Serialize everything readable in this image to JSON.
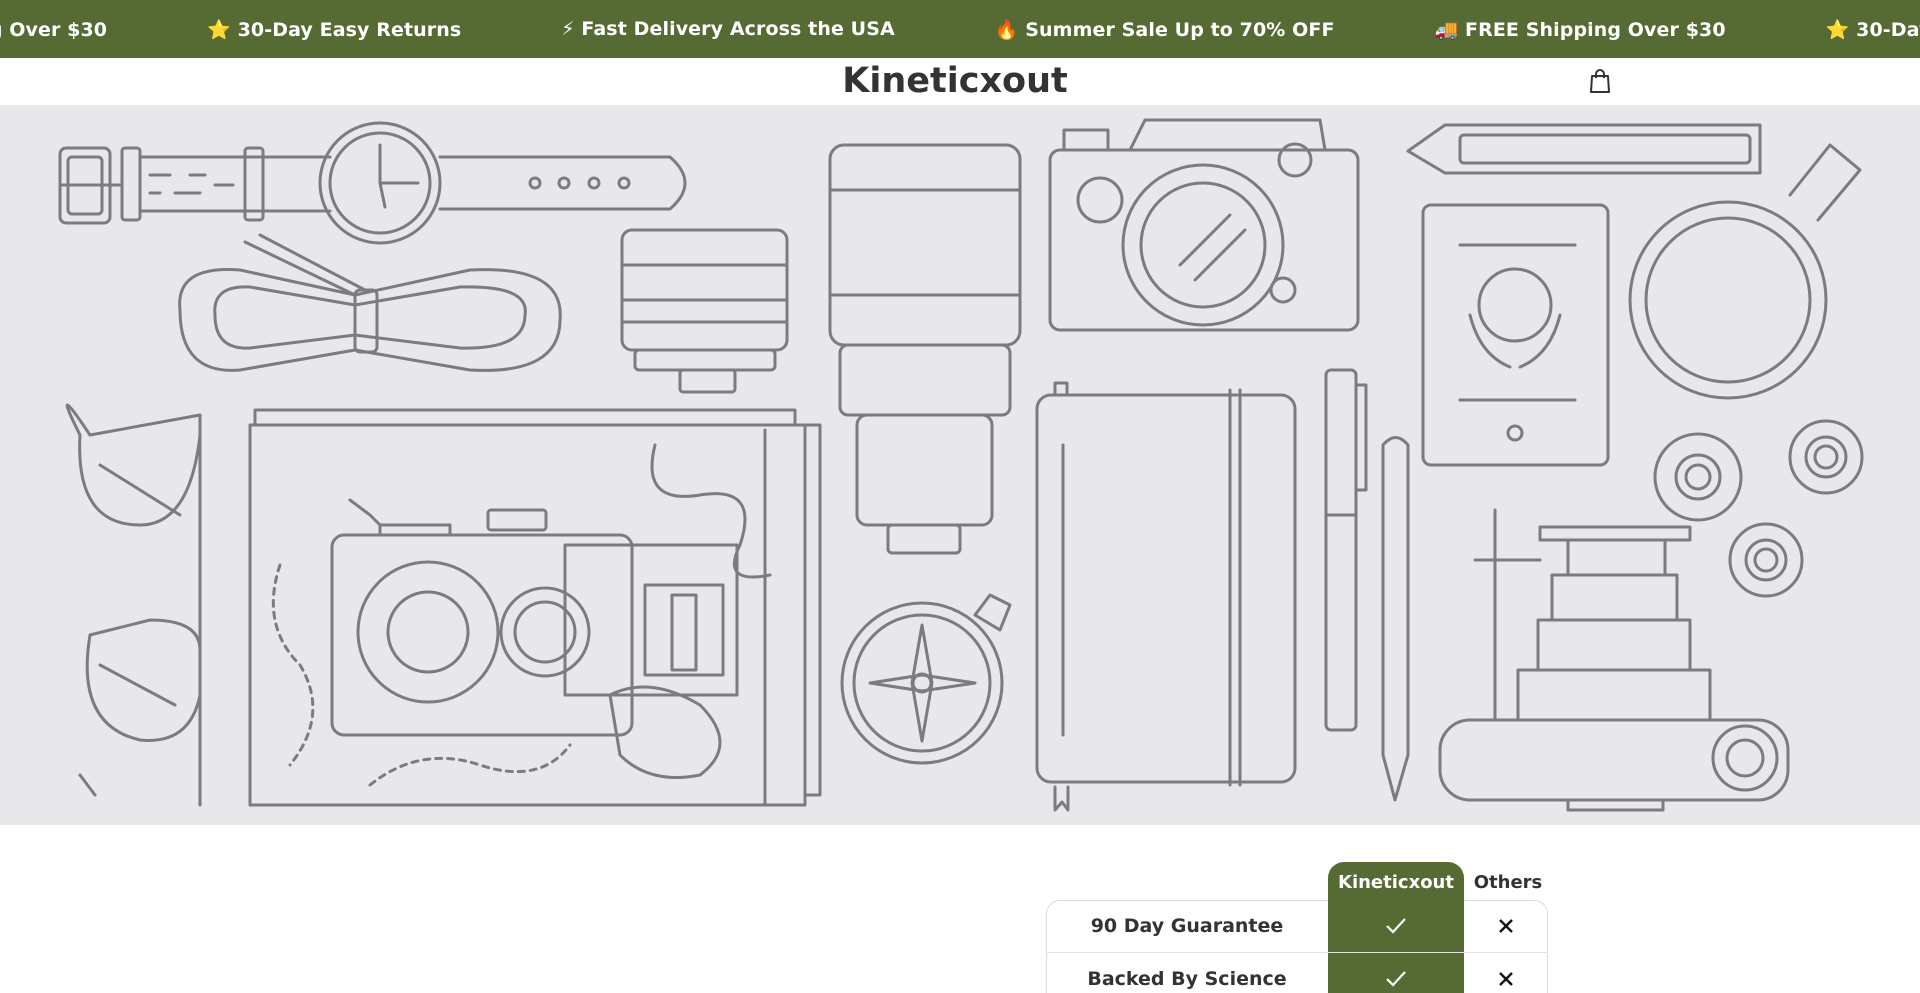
{
  "announcement": {
    "items": [
      "🚚 FREE Shipping Over $30",
      "⭐ 30-Day Easy Returns",
      "⚡ Fast Delivery Across the USA",
      "🔥 Summer Sale Up to 70% OFF",
      "🚚 FREE Shipping Over $30",
      "⭐ 30-Day Easy Returns"
    ],
    "background": "#566b33"
  },
  "header": {
    "brand": "Kineticxout",
    "cart_icon": "shopping-bag-icon"
  },
  "hero": {
    "illustration": "line-art flat lay of travel accessories",
    "background": "#e8e8ea"
  },
  "comparison": {
    "columns": [
      "Kineticxout",
      "Others"
    ],
    "rows": [
      {
        "label": "90 Day Guarantee",
        "brand": "check-icon",
        "others": "x-icon"
      },
      {
        "label": "Backed By Science",
        "brand": "check-icon",
        "others": "x-icon"
      }
    ],
    "accent": "#566b33"
  }
}
